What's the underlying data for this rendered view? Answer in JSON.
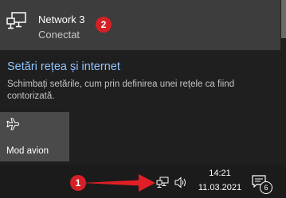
{
  "network": {
    "name": "Network 3",
    "status": "Conectat",
    "icon": "ethernet-network-icon"
  },
  "settings": {
    "link_label": "Setări rețea și internet",
    "description": "Schimbați setările, cum prin definirea unei rețele ca fiind contorizată."
  },
  "quick_actions": [
    {
      "label": "Mod avion",
      "icon": "airplane-icon"
    }
  ],
  "taskbar": {
    "time": "14:21",
    "date": "11.03.2021",
    "notification_count": "6",
    "tray_icons": [
      "network-tray-icon",
      "volume-icon",
      "notification-icon"
    ]
  },
  "annotations": {
    "badge_1": "1",
    "badge_2": "2"
  },
  "colors": {
    "link": "#8fc3ff",
    "badge": "#d42027",
    "panel_item": "#3d3d3d",
    "tile": "#4a4a4a"
  }
}
